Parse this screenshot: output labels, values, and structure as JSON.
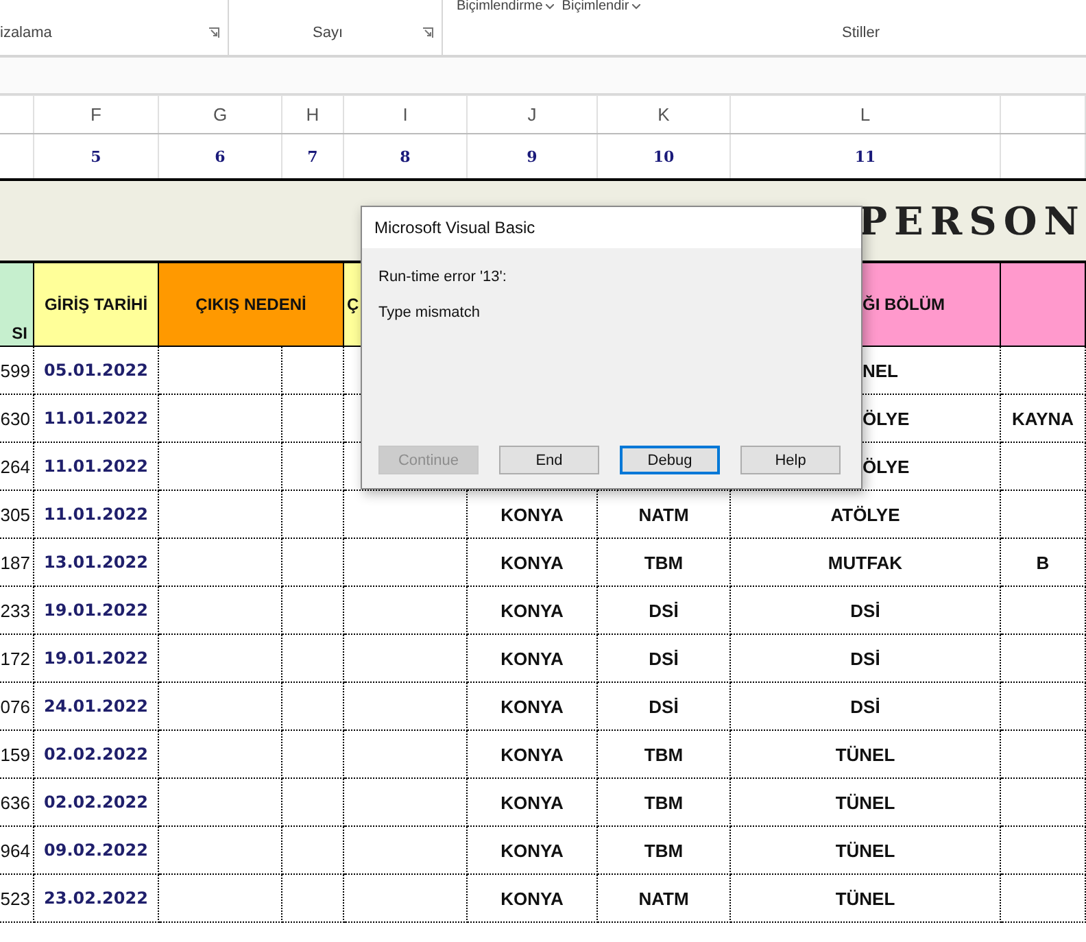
{
  "ribbon": {
    "top_buttons": [
      {
        "label": "Biçimlendirme"
      },
      {
        "label": "Biçimlendir"
      }
    ],
    "groups": [
      {
        "label": "izalama",
        "launcher": true
      },
      {
        "label": "Sayı",
        "launcher": true
      },
      {
        "label": "Stiller",
        "launcher": false
      }
    ]
  },
  "column_headers": [
    "F",
    "G",
    "H",
    "I",
    "J",
    "K",
    "L"
  ],
  "column_numbers": [
    "5",
    "6",
    "7",
    "8",
    "9",
    "10",
    "11"
  ],
  "title": "PERSON",
  "table": {
    "header": [
      {
        "text": "SI",
        "color": "#c6efce"
      },
      {
        "text": "GİRİŞ TARİHİ",
        "color": "#ffff99"
      },
      {
        "text": "ÇIKIŞ NEDENİ",
        "color": "#ff9900"
      },
      {
        "text": "Ç",
        "color": "#ffff99"
      },
      {
        "text": "ĞI BÖLÜM",
        "color": "#ff99cc"
      },
      {
        "color": "#ff99cc"
      }
    ],
    "rows": [
      {
        "column_e": "599",
        "giris_tarihi": "05.01.2022",
        "column_l": "NEL"
      },
      {
        "column_e": "630",
        "giris_tarihi": "11.01.2022",
        "column_l": "ÖLYE",
        "column_m": "KAYNA"
      },
      {
        "column_e": "264",
        "giris_tarihi": "11.01.2022",
        "column_l": "ÖLYE"
      },
      {
        "column_e": "305",
        "giris_tarihi": "11.01.2022",
        "column_j": "KONYA",
        "column_k": "NATM",
        "column_l": "ATÖLYE"
      },
      {
        "column_e": "187",
        "giris_tarihi": "13.01.2022",
        "column_j": "KONYA",
        "column_k": "TBM",
        "column_l": "MUTFAK",
        "column_m": "B"
      },
      {
        "column_e": "233",
        "giris_tarihi": "19.01.2022",
        "column_j": "KONYA",
        "column_k": "DSİ",
        "column_l": "DSİ"
      },
      {
        "column_e": "172",
        "giris_tarihi": "19.01.2022",
        "column_j": "KONYA",
        "column_k": "DSİ",
        "column_l": "DSİ"
      },
      {
        "column_e": "076",
        "giris_tarihi": "24.01.2022",
        "column_j": "KONYA",
        "column_k": "DSİ",
        "column_l": "DSİ"
      },
      {
        "column_e": "159",
        "giris_tarihi": "02.02.2022",
        "column_j": "KONYA",
        "column_k": "TBM",
        "column_l": "TÜNEL"
      },
      {
        "column_e": "636",
        "giris_tarihi": "02.02.2022",
        "column_j": "KONYA",
        "column_k": "TBM",
        "column_l": "TÜNEL"
      },
      {
        "column_e": "964",
        "giris_tarihi": "09.02.2022",
        "column_j": "KONYA",
        "column_k": "TBM",
        "column_l": "TÜNEL"
      },
      {
        "column_e": "523",
        "giris_tarihi": "23.02.2022",
        "column_j": "KONYA",
        "column_k": "NATM",
        "column_l": "TÜNEL"
      }
    ]
  },
  "dialog": {
    "title": "Microsoft Visual Basic",
    "message": "Run-time error '13':",
    "detail": "Type mismatch",
    "buttons": [
      {
        "label": "Continue",
        "disabled": true,
        "selected": false
      },
      {
        "label": "End",
        "disabled": false,
        "selected": false
      },
      {
        "label": "Debug",
        "disabled": false,
        "selected": true
      },
      {
        "label": "Help",
        "disabled": false,
        "selected": false
      }
    ]
  }
}
